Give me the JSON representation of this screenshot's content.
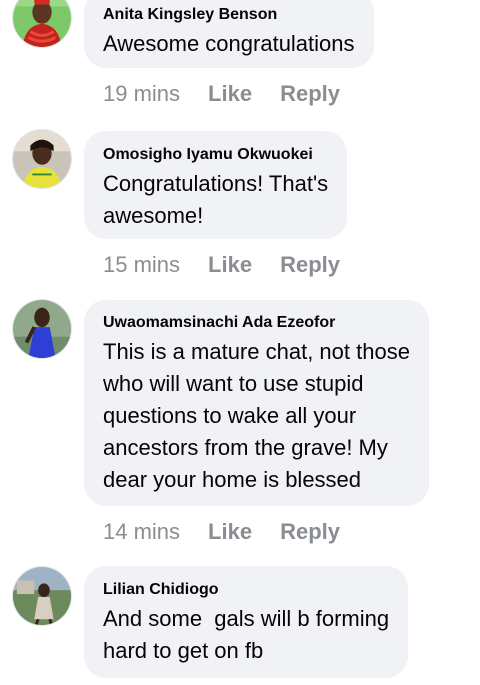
{
  "comments": [
    {
      "author": "Anita Kingsley Benson",
      "lines": [
        "Awesome congratulations"
      ],
      "time": "19 mins",
      "like": "Like",
      "reply": "Reply",
      "avatar_icon": "profile-photo-woman-red-coral-beads"
    },
    {
      "author": "Omosigho Iyamu Okwuokei",
      "lines": [
        "Congratulations! That's",
        "awesome!"
      ],
      "time": "15 mins",
      "like": "Like",
      "reply": "Reply",
      "avatar_icon": "profile-photo-woman-yellow-top"
    },
    {
      "author": "Uwaomamsinachi Ada Ezeofor",
      "lines": [
        "This is a mature chat, not those",
        "who will want to use stupid",
        "questions to wake all your",
        "ancestors from the grave! My",
        "dear your home is blessed"
      ],
      "time": "14 mins",
      "like": "Like",
      "reply": "Reply",
      "avatar_icon": "profile-photo-woman-blue-dress"
    },
    {
      "author": "Lilian Chidiogo",
      "lines": [
        "And some  gals will b forming",
        "hard to get on fb"
      ],
      "avatar_icon": "profile-photo-woman-outdoors"
    }
  ],
  "colors": {
    "bubble": "#f0f2f5",
    "text": "#050505",
    "meta": "#8a8d91"
  }
}
